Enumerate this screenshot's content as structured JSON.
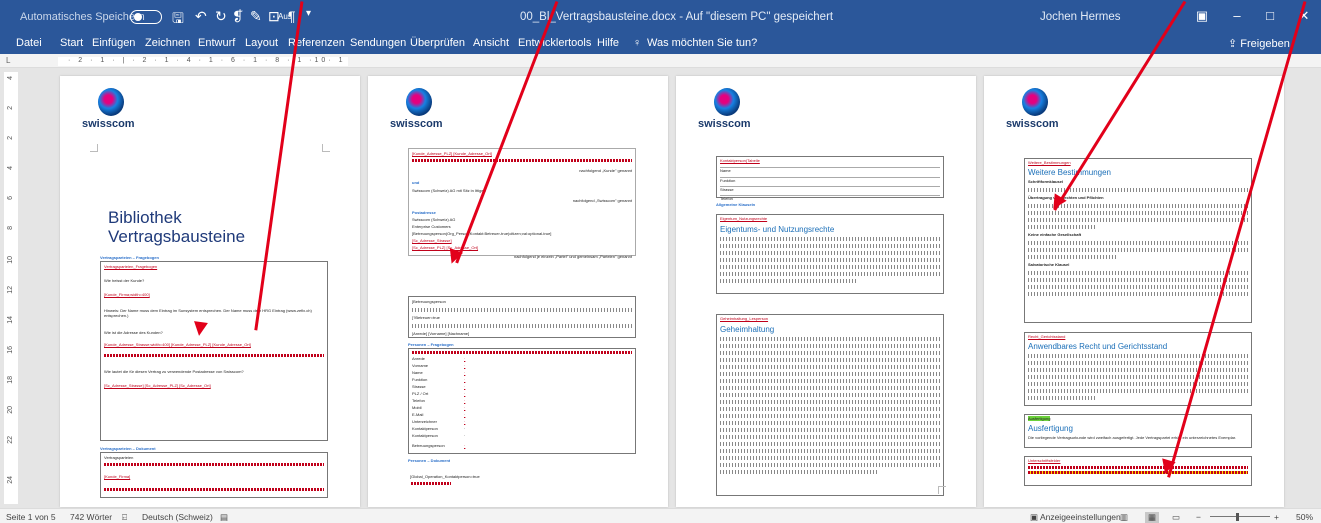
{
  "titlebar": {
    "autosave_label": "Automatisches Speichern",
    "autosave_state": "Aus",
    "document_title": "00_Bl_Vertragsbausteine.docx  -  Auf \"diesem PC\" gespeichert",
    "user": "Jochen Hermes",
    "min": "–",
    "max": "□",
    "close": "✕"
  },
  "ribbon": {
    "tabs": [
      "Datei",
      "Start",
      "Einfügen",
      "Zeichnen",
      "Entwurf",
      "Layout",
      "Referenzen",
      "Sendungen",
      "Überprüfen",
      "Ansicht",
      "Entwicklertools",
      "Hilfe"
    ],
    "tell_me": "Was möchten Sie tun?",
    "share": "Freigeben"
  },
  "ruler": {
    "marks": "· 2 · 1 · | · 2 · 1 · 4 · 1 · 6 · 1 · 8 · 1 ·10· 1 ·12· 1 ·14· 1 ·16· 1 ·",
    "corner": "L",
    "vmarks": [
      "4",
      "2",
      "2",
      "4",
      "6",
      "8",
      "10",
      "12",
      "14",
      "16",
      "18",
      "20",
      "22",
      "24"
    ]
  },
  "logo": {
    "text": "swisscom"
  },
  "page1": {
    "title_line1": "Bibliothek",
    "title_line2": "Vertragsbausteine",
    "section1": "Vertragsparteien – Fragebogen",
    "field_red1": "Vertragsparteien_Fragebogen",
    "q1": "Wie heisst der Kunde?",
    "a1": "[Kunde_Firma;width=400]",
    "hint": "Hinweis: Der Name muss dem Eintrag im Sunsystem entsprechen. Der Name muss dem HRG Eintrag (www.zefix.ch) entsprechen.)",
    "q2": "Wie ist die Adresse des Kunden?",
    "a2": "[Kunde_Adresse_Strasse;width=400] [Kunde_Adresse_PLZ] [Kunde_Adresse_Ort]",
    "q3": "Wie lautet die für diesen Vertrag zu verwendende Postadresse von Swisscom?",
    "a3": "[Sc_Adresse_Strasse] [Sc_Adresse_PLZ] [Sc_Adresse_Ort]",
    "section2": "Vertragsparteien – Dokument",
    "doc_field": "Vertragsparteien",
    "doc_red": "[Kunde_Firma]"
  },
  "page2": {
    "red_top": "[Kunde_Adresse_PLZ] [Kunde_Adresse_Ort]",
    "nachfolgend_kunde": "nachfolgend „Kunde\" genannt",
    "und": "und",
    "swisscom": "Swisscom (Schweiz) AG mit Sitz in Ittigen",
    "nachfolgend_sc": "nachfolgend „Swisscom\" genannt",
    "postadresse": "Postadresse",
    "sc_lines": [
      "Swisscom (Schweiz) AG",
      "Enterprise Customers",
      "[Betreuungsperson(Org_Person;Kontakt:Betreuer-true)citizen;val:optional-true]",
      "[Sc_Adresse_Strasse]",
      "[Sc_Adresse_PLZ] [Sc_Adresse_Ort]"
    ],
    "parteien": "nachfolgend je einzeln „Partei\" und gemeinsam „Parteien\" genannt",
    "betreuung": "[Betreuungsperson",
    "betreuer_true": "[?Betreuer=true",
    "anrede": "[Anrede] [Vorname] [Nachname]",
    "personen": "Personen – Fragebogen",
    "personen_fields": [
      "Anrede",
      "Vorname",
      "Name",
      "Funktion",
      "Strasse",
      "PLZ / Ort",
      "Telefon",
      "Mobil",
      "E-Mail",
      "Unterzeichner",
      "Kontaktperson",
      "Kontaktperson",
      "Betreuungsperson"
    ],
    "personen_dok": "Personen – Dokument",
    "bottom": "[Global_Operation_Kontaktperson=true"
  },
  "page3": {
    "red_head": "Kontaktperson(Tabelle",
    "rows": [
      "Name",
      "Funktion",
      "Strasse",
      "Telefon"
    ],
    "allg": "Allgemeine Klauseln",
    "eigentum_red": "Eigentum_Nutzungsrechte",
    "eigentum": "Eigentums- und Nutzungsrechte",
    "geheim_red": "Geheimhaltung_Lesperson",
    "geheim": "Geheimhaltung"
  },
  "page4": {
    "weitere_red": "Weitere_Bestimmungen",
    "weitere": "Weitere Bestimmungen",
    "s1": "Schriftformklausel",
    "s2": "Übertragung von Rechten und Pflichten",
    "s3": "Keine einfache Gesellschaft",
    "s4": "Salvatorische Klausel",
    "recht_red": "Recht_Gerichtsstand",
    "recht": "Anwendbares Recht und Gerichtsstand",
    "ausfertigung_hl": "Ausfertigung",
    "ausfertigung": "Ausfertigung",
    "ausf_text": "Die vorliegende Vertragsurkunde wird zweifach ausgefertigt. Jede Vertragspartei erhält ein unterzeichnetes Exemplar.",
    "unterschrift_red": "Unterschriftsfelder"
  },
  "status": {
    "page": "Seite 1 von 5",
    "words": "742 Wörter",
    "language": "Deutsch (Schweiz)",
    "display": "Anzeigeeinstellungen",
    "zoom": "50%"
  },
  "colors": {
    "ribbon": "#2b579a",
    "annotation_arrow": "#e2001a",
    "heading_blue": "#1b6fb8",
    "title_blue": "#1f3a7a",
    "field_red": "#c0001a",
    "highlight_green": "#6cd23b"
  }
}
